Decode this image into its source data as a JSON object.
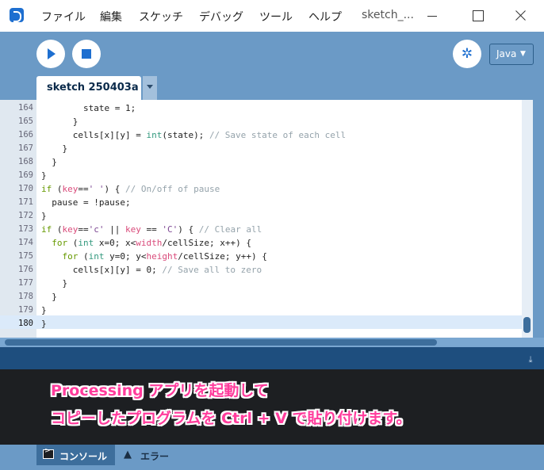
{
  "titlebar": {
    "menu": [
      "ファイル",
      "編集",
      "スケッチ",
      "デバッグ",
      "ツール",
      "ヘルプ"
    ],
    "window_title": "sketch_..."
  },
  "toolbar": {
    "mode": "Java"
  },
  "tab": {
    "name": "sketch 250403a"
  },
  "editor": {
    "lines": [
      {
        "num": "164",
        "segs": [
          {
            "t": "        state = 1;",
            "c": "plain"
          }
        ]
      },
      {
        "num": "165",
        "segs": [
          {
            "t": "      }",
            "c": "plain"
          }
        ]
      },
      {
        "num": "166",
        "segs": [
          {
            "t": "      cells[x][y] = ",
            "c": "plain"
          },
          {
            "t": "int",
            "c": "kw"
          },
          {
            "t": "(state); ",
            "c": "plain"
          },
          {
            "t": "// Save state of each cell",
            "c": "cm"
          }
        ]
      },
      {
        "num": "167",
        "segs": [
          {
            "t": "    }",
            "c": "plain"
          }
        ]
      },
      {
        "num": "168",
        "segs": [
          {
            "t": "  }",
            "c": "plain"
          }
        ]
      },
      {
        "num": "169",
        "segs": [
          {
            "t": "}",
            "c": "plain"
          }
        ]
      },
      {
        "num": "170",
        "segs": [
          {
            "t": "if",
            "c": "kw2"
          },
          {
            "t": " (",
            "c": "plain"
          },
          {
            "t": "key",
            "c": "sys"
          },
          {
            "t": "==",
            "c": "plain"
          },
          {
            "t": "' '",
            "c": "str"
          },
          {
            "t": ") { ",
            "c": "plain"
          },
          {
            "t": "// On/off of pause",
            "c": "cm"
          }
        ]
      },
      {
        "num": "171",
        "segs": [
          {
            "t": "  pause = !pause;",
            "c": "plain"
          }
        ]
      },
      {
        "num": "172",
        "segs": [
          {
            "t": "}",
            "c": "plain"
          }
        ]
      },
      {
        "num": "173",
        "segs": [
          {
            "t": "if",
            "c": "kw2"
          },
          {
            "t": " (",
            "c": "plain"
          },
          {
            "t": "key",
            "c": "sys"
          },
          {
            "t": "==",
            "c": "plain"
          },
          {
            "t": "'c'",
            "c": "str"
          },
          {
            "t": " || ",
            "c": "plain"
          },
          {
            "t": "key",
            "c": "sys"
          },
          {
            "t": " == ",
            "c": "plain"
          },
          {
            "t": "'C'",
            "c": "str"
          },
          {
            "t": ") { ",
            "c": "plain"
          },
          {
            "t": "// Clear all",
            "c": "cm"
          }
        ]
      },
      {
        "num": "174",
        "segs": [
          {
            "t": "  ",
            "c": "plain"
          },
          {
            "t": "for",
            "c": "kw2"
          },
          {
            "t": " (",
            "c": "plain"
          },
          {
            "t": "int",
            "c": "kw"
          },
          {
            "t": " x=0; x<",
            "c": "plain"
          },
          {
            "t": "width",
            "c": "sys"
          },
          {
            "t": "/cellSize; x++) {",
            "c": "plain"
          }
        ]
      },
      {
        "num": "175",
        "segs": [
          {
            "t": "    ",
            "c": "plain"
          },
          {
            "t": "for",
            "c": "kw2"
          },
          {
            "t": " (",
            "c": "plain"
          },
          {
            "t": "int",
            "c": "kw"
          },
          {
            "t": " y=0; y<",
            "c": "plain"
          },
          {
            "t": "height",
            "c": "sys"
          },
          {
            "t": "/cellSize; y++) {",
            "c": "plain"
          }
        ]
      },
      {
        "num": "176",
        "segs": [
          {
            "t": "      cells[x][y] = 0; ",
            "c": "plain"
          },
          {
            "t": "// Save all to zero",
            "c": "cm"
          }
        ]
      },
      {
        "num": "177",
        "segs": [
          {
            "t": "    }",
            "c": "plain"
          }
        ]
      },
      {
        "num": "178",
        "segs": [
          {
            "t": "  }",
            "c": "plain"
          }
        ]
      },
      {
        "num": "179",
        "segs": [
          {
            "t": "}",
            "c": "plain"
          }
        ]
      },
      {
        "num": "180",
        "segs": [
          {
            "t": "}",
            "c": "plain"
          }
        ]
      }
    ]
  },
  "console": {
    "caption_line1": "Processing アプリを起動して",
    "caption_line2": "コピーしたプログラムを Ctrl + V で貼り付けます。"
  },
  "footer": {
    "console_tab": "コンソール",
    "errors_tab": "エラー"
  },
  "colors": {
    "keyword": "#33997e",
    "control": "#669900",
    "system": "#d94a7a",
    "string": "#7d4793",
    "comment": "#95a3ab",
    "accent": "#1e6fd0",
    "caption": "#ff3c9c"
  },
  "icons": [
    "app-icon",
    "play-icon",
    "stop-icon",
    "debug-icon",
    "dropdown-arrow-icon",
    "terminal-icon",
    "warning-icon",
    "collapse-icon"
  ]
}
